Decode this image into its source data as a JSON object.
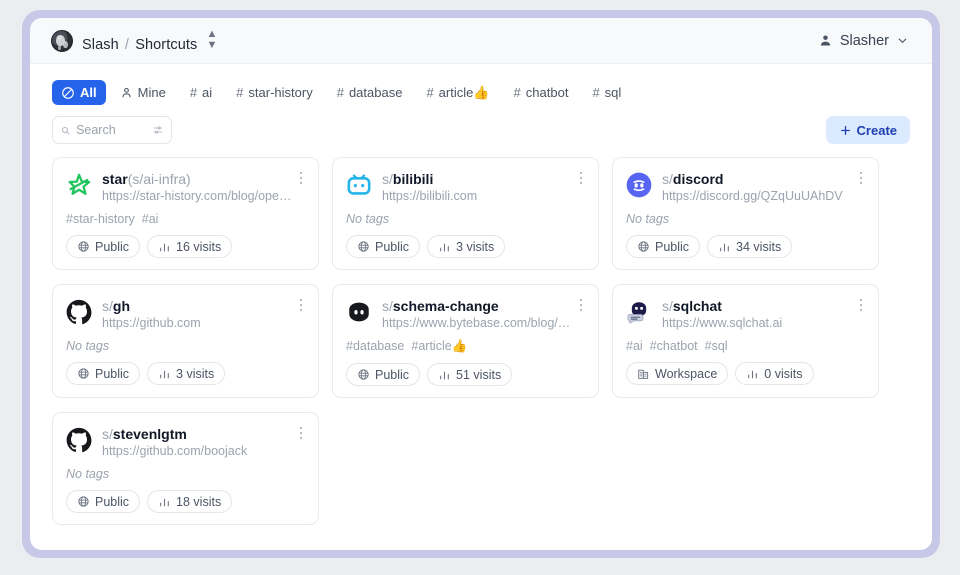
{
  "header": {
    "brand_app": "Slash",
    "brand_sep": "/",
    "brand_page": "Shortcuts",
    "user_name": "Slasher"
  },
  "filters": [
    {
      "label": "All",
      "icon": "circle-slash-icon",
      "active": true
    },
    {
      "label": "Mine",
      "icon": "person-icon",
      "active": false
    },
    {
      "label": "ai",
      "icon": "hash",
      "active": false
    },
    {
      "label": "star-history",
      "icon": "hash",
      "active": false
    },
    {
      "label": "database",
      "icon": "hash",
      "active": false
    },
    {
      "label": "article👍",
      "icon": "hash",
      "active": false
    },
    {
      "label": "chatbot",
      "icon": "hash",
      "active": false
    },
    {
      "label": "sql",
      "icon": "hash",
      "active": false
    }
  ],
  "toolbar": {
    "search_value": "",
    "search_placeholder": "Search",
    "search_icon": "search-icon",
    "filter_icon": "sliders-icon",
    "create_label": "Create",
    "create_icon": "plus-icon"
  },
  "labels": {
    "no_tags": "No tags",
    "hash": "#",
    "slash_prefix": "s/"
  },
  "shortcuts": [
    {
      "favicon": "star-history-icon",
      "prefix": "",
      "name": "star",
      "suffix": "(s/ai-infra)",
      "url": "https://star-history.com/blog/open-…",
      "tags": [
        "#star-history",
        "#ai"
      ],
      "visibility": "Public",
      "visibility_icon": "globe-icon",
      "visits": "16 visits"
    },
    {
      "favicon": "bilibili-icon",
      "prefix": "s/",
      "name": "bilibili",
      "suffix": "",
      "url": "https://bilibili.com",
      "tags": [],
      "visibility": "Public",
      "visibility_icon": "globe-icon",
      "visits": "3 visits"
    },
    {
      "favicon": "discord-icon",
      "prefix": "s/",
      "name": "discord",
      "suffix": "",
      "url": "https://discord.gg/QZqUuUAhDV",
      "tags": [],
      "visibility": "Public",
      "visibility_icon": "globe-icon",
      "visits": "34 visits"
    },
    {
      "favicon": "github-icon",
      "prefix": "s/",
      "name": "gh",
      "suffix": "",
      "url": "https://github.com",
      "tags": [],
      "visibility": "Public",
      "visibility_icon": "globe-icon",
      "visits": "3 visits"
    },
    {
      "favicon": "bytebase-icon",
      "prefix": "s/",
      "name": "schema-change",
      "suffix": "",
      "url": "https://www.bytebase.com/blog/ho…",
      "tags": [
        "#database",
        "#article👍"
      ],
      "visibility": "Public",
      "visibility_icon": "globe-icon",
      "visits": "51 visits"
    },
    {
      "favicon": "sqlchat-icon",
      "prefix": "s/",
      "name": "sqlchat",
      "suffix": "",
      "url": "https://www.sqlchat.ai",
      "tags": [
        "#ai",
        "#chatbot",
        "#sql"
      ],
      "visibility": "Workspace",
      "visibility_icon": "building-icon",
      "visits": "0 visits"
    },
    {
      "favicon": "github-icon",
      "prefix": "s/",
      "name": "stevenlgtm",
      "suffix": "",
      "url": "https://github.com/boojack",
      "tags": [],
      "visibility": "Public",
      "visibility_icon": "globe-icon",
      "visits": "18 visits"
    }
  ],
  "colors": {
    "accent": "#2563eb",
    "create_bg": "#dbeafe",
    "create_fg": "#1e40af",
    "frame": "#c7c8e8",
    "page_bg": "#ebedf0"
  }
}
